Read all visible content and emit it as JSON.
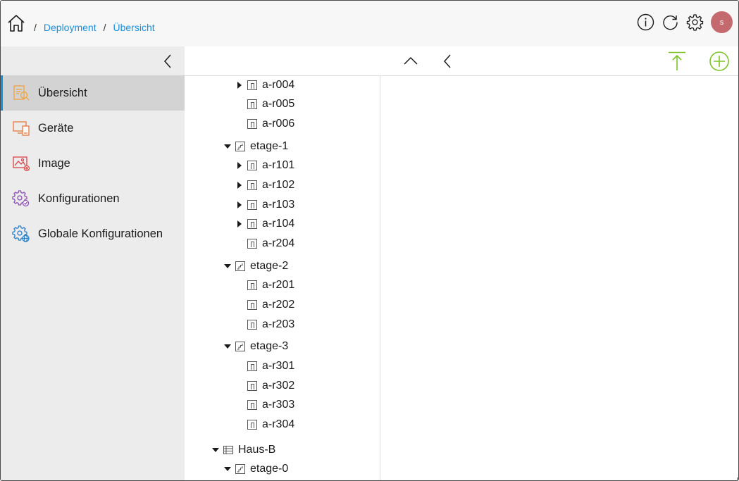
{
  "breadcrumb": {
    "separator": "/",
    "items": [
      "Deployment",
      "Übersicht"
    ]
  },
  "user": {
    "initial": "s",
    "avatar_color": "#c46a6e"
  },
  "colors": {
    "accent": "#1c8ed8",
    "add_green": "#7dc42b",
    "sidebar_bg": "#ececec",
    "sidebar_active": "#d3d3d3"
  },
  "top_icons": [
    "info-icon",
    "refresh-icon",
    "gear-icon"
  ],
  "sidebar": {
    "items": [
      {
        "label": "Übersicht",
        "icon": "overview-icon",
        "active": true
      },
      {
        "label": "Geräte",
        "icon": "devices-icon",
        "active": false
      },
      {
        "label": "Image",
        "icon": "image-icon",
        "active": false
      },
      {
        "label": "Konfigurationen",
        "icon": "config-icon",
        "active": false
      },
      {
        "label": "Globale Konfigurationen",
        "icon": "global-config-icon",
        "active": false
      }
    ]
  },
  "tree": [
    {
      "label": "a-r004",
      "type": "room",
      "level": 3,
      "caret": "right"
    },
    {
      "label": "a-r005",
      "type": "room",
      "level": 3,
      "caret": "none"
    },
    {
      "label": "a-r006",
      "type": "room",
      "level": 3,
      "caret": "none"
    },
    {
      "label": "etage-1",
      "type": "floor",
      "level": 2,
      "caret": "down"
    },
    {
      "label": "a-r101",
      "type": "room",
      "level": 3,
      "caret": "right"
    },
    {
      "label": "a-r102",
      "type": "room",
      "level": 3,
      "caret": "right"
    },
    {
      "label": "a-r103",
      "type": "room",
      "level": 3,
      "caret": "right"
    },
    {
      "label": "a-r104",
      "type": "room",
      "level": 3,
      "caret": "right"
    },
    {
      "label": "a-r204",
      "type": "room",
      "level": 3,
      "caret": "none"
    },
    {
      "label": "etage-2",
      "type": "floor",
      "level": 2,
      "caret": "down"
    },
    {
      "label": "a-r201",
      "type": "room",
      "level": 3,
      "caret": "none"
    },
    {
      "label": "a-r202",
      "type": "room",
      "level": 3,
      "caret": "none"
    },
    {
      "label": "a-r203",
      "type": "room",
      "level": 3,
      "caret": "none"
    },
    {
      "label": "etage-3",
      "type": "floor",
      "level": 2,
      "caret": "down"
    },
    {
      "label": "a-r301",
      "type": "room",
      "level": 3,
      "caret": "none"
    },
    {
      "label": "a-r302",
      "type": "room",
      "level": 3,
      "caret": "none"
    },
    {
      "label": "a-r303",
      "type": "room",
      "level": 3,
      "caret": "none"
    },
    {
      "label": "a-r304",
      "type": "room",
      "level": 3,
      "caret": "none"
    },
    {
      "label": "Haus-B",
      "type": "building",
      "level": 1,
      "caret": "down"
    },
    {
      "label": "etage-0",
      "type": "floor",
      "level": 2,
      "caret": "down"
    }
  ]
}
